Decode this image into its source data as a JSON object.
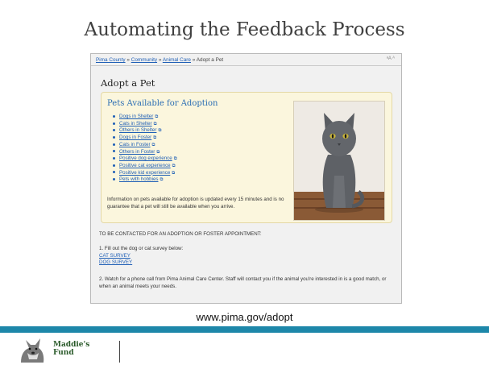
{
  "slide": {
    "title": "Automating the Feedback Process",
    "url": "www.pima.gov/adopt"
  },
  "breadcrumb": {
    "items": [
      "Pima County",
      "Community",
      "Animal Care"
    ],
    "current": "Adopt a Pet",
    "sep": "»",
    "text_size_label": "ᵃA ᴬ"
  },
  "page": {
    "heading": "Adopt a Pet",
    "box_title": "Pets Available for Adoption",
    "links": [
      "Dogs in Shelter",
      "Cats in Shelter",
      "Others in Shelter",
      "Dogs in Foster",
      "Cats in Foster",
      "Others in Foster",
      "Positive dog experience",
      "Positive cat experience",
      "Positive kid experience",
      "Pets with hobbies"
    ],
    "info": "Information on pets available for adoption is updated every 15 minutes and is no guarantee that a pet will still be available when you arrive.",
    "contact_heading": "TO BE CONTACTED FOR AN ADOPTION OR FOSTER APPOINTMENT:",
    "step1": "1.    Fill out the dog or cat survey below:",
    "cat_survey": "CAT SURVEY",
    "dog_survey": "DOG SURVEY",
    "step2": "2.   Watch for a phone call from Pima Animal Care Center. Staff will contact you if the animal you're interested in is a good match, or when an animal meets your needs."
  },
  "footer": {
    "logo_line1": "Maddie's",
    "logo_line2": "Fund"
  },
  "colors": {
    "accent_band": "#1d87a9",
    "link": "#1f5fb6",
    "box_bg": "#fbf6dd"
  }
}
